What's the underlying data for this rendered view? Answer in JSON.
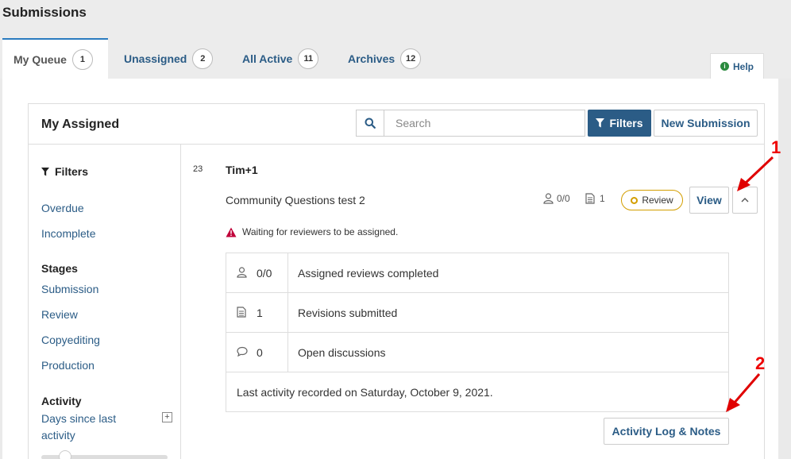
{
  "page": {
    "title": "Submissions"
  },
  "tabs": [
    {
      "label": "My Queue",
      "count": "1"
    },
    {
      "label": "Unassigned",
      "count": "2"
    },
    {
      "label": "All Active",
      "count": "11"
    },
    {
      "label": "Archives",
      "count": "12"
    }
  ],
  "help": {
    "label": "Help",
    "icon": "info-icon"
  },
  "panel": {
    "title": "My Assigned",
    "search_placeholder": "Search",
    "filters_button": "Filters",
    "new_submission_button": "New Submission"
  },
  "sidebar": {
    "filters_title": "Filters",
    "quick_filters": [
      "Overdue",
      "Incomplete"
    ],
    "stages_heading": "Stages",
    "stages": [
      "Submission",
      "Review",
      "Copyediting",
      "Production"
    ],
    "activity_heading": "Activity",
    "activity_filter": "Days since last activity",
    "expand_symbol": "+"
  },
  "submission": {
    "id": "23",
    "author": "Tim+1",
    "title": "Community Questions test 2",
    "reviews": "0/0",
    "files": "1",
    "stage": "Review",
    "view_button": "View",
    "warning": "Waiting for reviewers to be assigned."
  },
  "details": {
    "rows": [
      {
        "icon": "user-icon",
        "count": "0/0",
        "label": "Assigned reviews completed"
      },
      {
        "icon": "document-icon",
        "count": "1",
        "label": "Revisions submitted"
      },
      {
        "icon": "comment-icon",
        "count": "0",
        "label": "Open discussions"
      }
    ],
    "last_activity": "Last activity recorded on Saturday, October 9, 2021."
  },
  "activity_button": "Activity Log & Notes",
  "annotations": {
    "one": "1",
    "two": "2"
  },
  "colors": {
    "primary": "#2b5c86",
    "accent": "#2b7bbf",
    "warning": "#d00",
    "review": "#d39e00",
    "callout": "#e00000"
  }
}
